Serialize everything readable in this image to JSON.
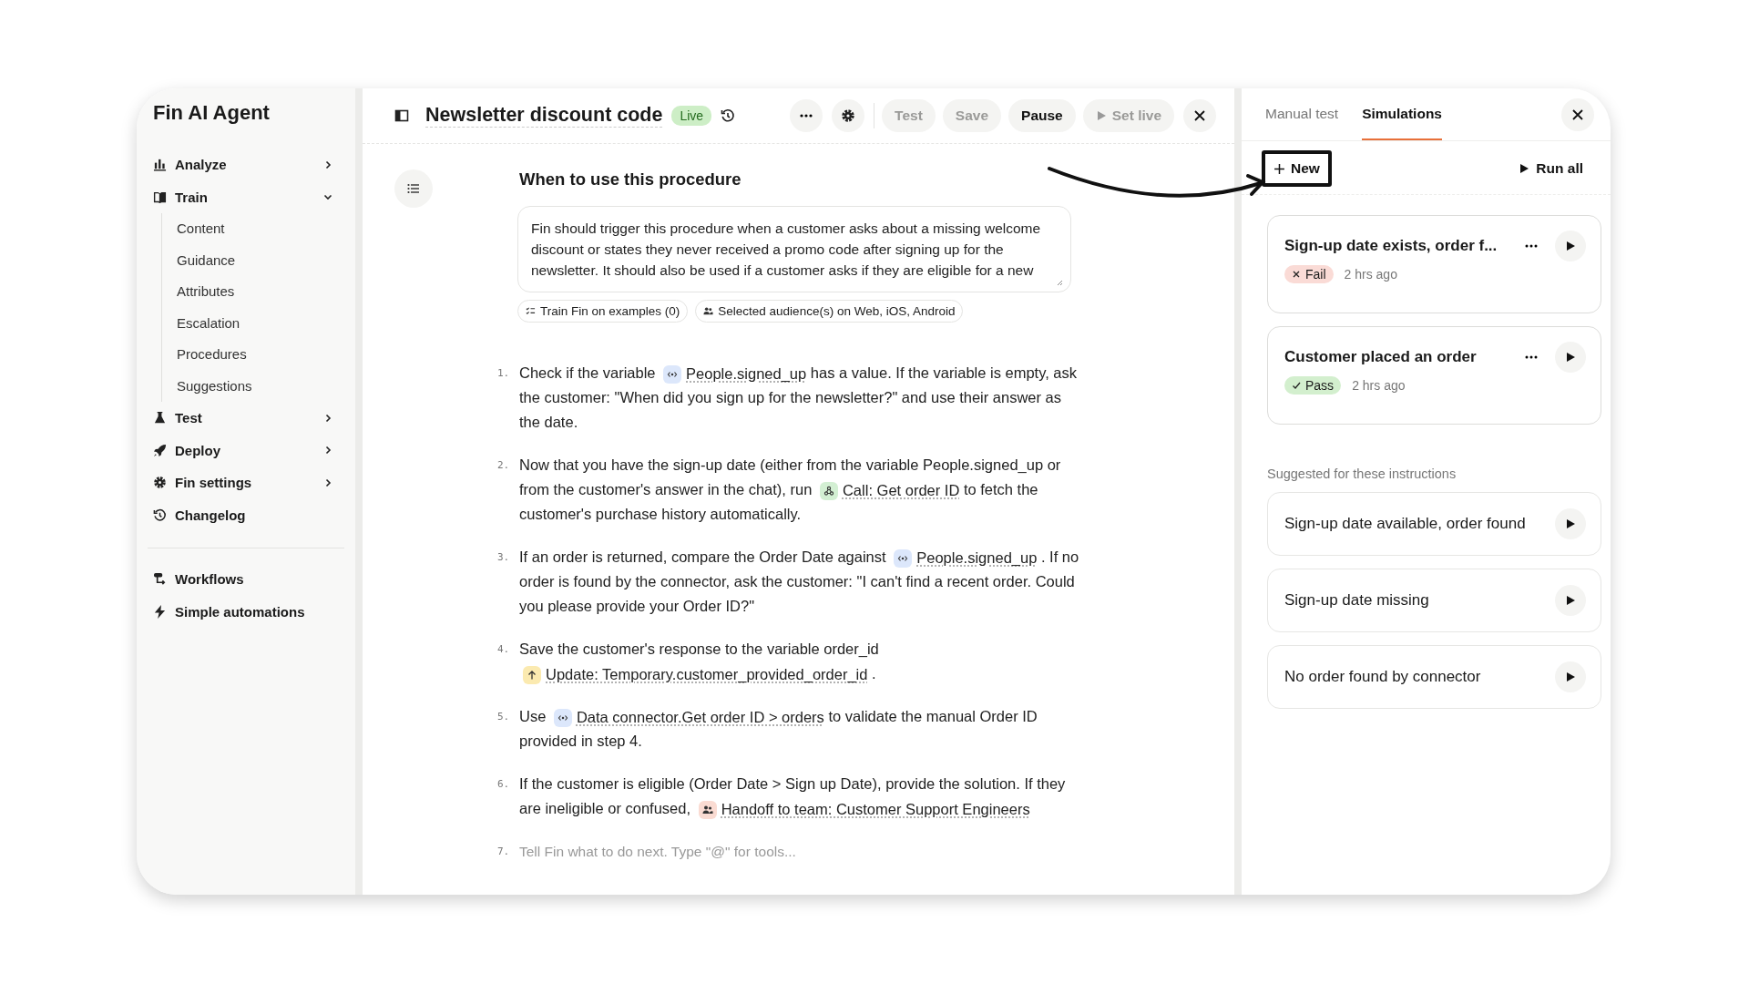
{
  "sidebar": {
    "title": "Fin AI Agent",
    "items": [
      {
        "label": "Analyze",
        "expanded": false
      },
      {
        "label": "Train",
        "expanded": true,
        "children": [
          {
            "label": "Content"
          },
          {
            "label": "Guidance"
          },
          {
            "label": "Attributes"
          },
          {
            "label": "Escalation"
          },
          {
            "label": "Procedures"
          },
          {
            "label": "Suggestions"
          }
        ]
      },
      {
        "label": "Test",
        "expanded": false
      },
      {
        "label": "Deploy",
        "expanded": false
      },
      {
        "label": "Fin settings",
        "expanded": false
      },
      {
        "label": "Changelog"
      }
    ],
    "secondary_items": [
      {
        "label": "Workflows"
      },
      {
        "label": "Simple automations"
      }
    ]
  },
  "editor": {
    "title": "Newsletter discount code",
    "status": "Live",
    "buttons": [
      {
        "label": "Test",
        "kind": "text",
        "disabled": true
      },
      {
        "label": "Save",
        "kind": "text",
        "disabled": true
      },
      {
        "label": "Pause",
        "kind": "text",
        "disabled": false
      },
      {
        "label": "Set live",
        "kind": "play",
        "disabled": true
      }
    ],
    "heading": "When to use this procedure",
    "trigger_text": "Fin should trigger this procedure when a customer asks about a missing welcome discount or states they never received a promo code after signing up for the newsletter. It should also be used if a customer asks if they are eligible for a new",
    "chips": [
      "Train Fin on examples (0)",
      "Selected audience(s) on Web, iOS, Android"
    ],
    "steps": [
      {
        "number": "1.",
        "parts": [
          {
            "kind": "text",
            "text": "Check if the variable "
          },
          {
            "kind": "variable",
            "text": "People.signed_up",
            "color": "#dce7fb"
          },
          {
            "kind": "text",
            "text": " has a value. If the variable is empty, ask the customer: \"When did you sign up for the newsletter?\" and use their answer as the date."
          }
        ]
      },
      {
        "number": "2.",
        "parts": [
          {
            "kind": "text",
            "text": "Now that you have the sign-up date (either from the variable People.signed_up or from the customer's answer in the chat), run "
          },
          {
            "kind": "webhook",
            "text": "Call: Get order ID",
            "color": "#d3efd3"
          },
          {
            "kind": "text",
            "text": " to fetch the customer's purchase history automatically."
          }
        ]
      },
      {
        "number": "3.",
        "parts": [
          {
            "kind": "text",
            "text": "If an order is returned, compare the Order Date against "
          },
          {
            "kind": "variable",
            "text": "People.signed_up",
            "color": "#dce7fb"
          },
          {
            "kind": "text",
            "text": " . If no order is found by the connector, ask the customer: \"I can't find a recent order. Could you please provide your Order ID?\""
          }
        ]
      },
      {
        "number": "4.",
        "parts": [
          {
            "kind": "text",
            "text": "Save the customer's response to the variable order_id "
          },
          {
            "kind": "update",
            "text": "Update: Temporary.customer_provided_order_id",
            "color": "#fbeab0"
          },
          {
            "kind": "text",
            "text": " ."
          }
        ]
      },
      {
        "number": "5.",
        "parts": [
          {
            "kind": "text",
            "text": "Use "
          },
          {
            "kind": "variable",
            "text": "Data connector.Get order ID > orders",
            "color": "#dce7fb"
          },
          {
            "kind": "text",
            "text": " to validate the manual Order ID provided in step 4."
          }
        ]
      },
      {
        "number": "6.",
        "parts": [
          {
            "kind": "text",
            "text": "If the customer is eligible (Order Date > Sign up Date), provide the solution. If they are ineligible or confused, "
          },
          {
            "kind": "handoff",
            "text": "Handoff to team: Customer Support Engineers",
            "color": "#fadbd2"
          }
        ]
      }
    ],
    "next_step": {
      "number": "7.",
      "placeholder": "Tell Fin what to do next. Type \"@\" for tools..."
    }
  },
  "test_panel": {
    "tabs": [
      {
        "label": "Manual test",
        "selected": false
      },
      {
        "label": "Simulations",
        "selected": true
      }
    ],
    "new_button": "New",
    "run_all": "Run all",
    "simulations": [
      {
        "title": "Sign-up date exists, order f...",
        "result": "Fail",
        "passed": false,
        "time": "2 hrs ago"
      },
      {
        "title": "Customer placed an order",
        "result": "Pass",
        "passed": true,
        "time": "2 hrs ago"
      }
    ],
    "suggested_heading": "Suggested for these instructions",
    "suggestions": [
      "Sign-up date available, order found",
      "Sign-up date missing",
      "No order found by connector"
    ]
  }
}
